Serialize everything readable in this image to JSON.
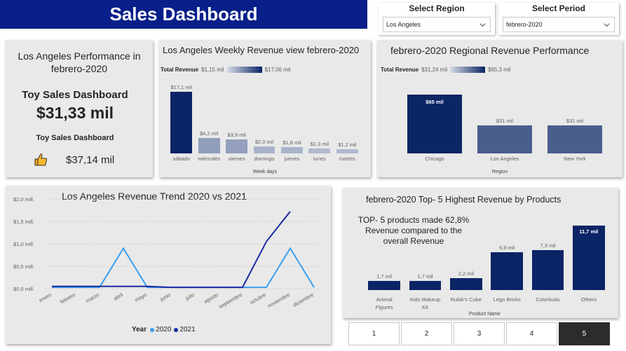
{
  "header": {
    "title": "Sales Dashboard"
  },
  "region_slicer": {
    "label": "Select Region",
    "value": "Los Angeles"
  },
  "period_slicer": {
    "label": "Select Period",
    "value": "febrero-2020"
  },
  "kpi": {
    "title": "Los Angeles Performance in febrero-2020",
    "subtitle": "Toy Sales Dashboard",
    "value": "$31,33 mil",
    "target_label": "Toy Sales Dashboard",
    "target_value": "$37,14 mil",
    "icon": "thumbs-up-icon"
  },
  "weekly": {
    "title": "Los Angeles Weekly Revenue view febrero-2020",
    "legend_label": "Total Revenue",
    "legend_min": "$1,15 mil",
    "legend_max": "$17,06 mil",
    "xlabel": "Week days",
    "chart_data": {
      "type": "bar",
      "categories": [
        "sábado",
        "miércoles",
        "viernes",
        "domingo",
        "jueves",
        "lunes",
        "martes"
      ],
      "values": [
        17.1,
        4.2,
        3.9,
        2.0,
        1.8,
        1.3,
        1.2
      ],
      "labels": [
        "$17,1 mil",
        "$4,2 mil",
        "$3,9 mil",
        "$2,0 mil",
        "$1,8 mil",
        "$1,3 mil",
        "$1,2 mil"
      ],
      "xlabel": "Week days"
    }
  },
  "regional": {
    "title": "febrero-2020 Regional Revenue Performance",
    "legend_label": "Total Revenue",
    "legend_min": "$31,24 mil",
    "legend_max": "$65,3 mil",
    "xlabel": "Region",
    "chart_data": {
      "type": "bar",
      "categories": [
        "Chicago",
        "Los Angeles",
        "New York"
      ],
      "values": [
        65,
        31,
        31
      ],
      "labels": [
        "$65 mil",
        "$31 mil",
        "$31 mil"
      ],
      "xlabel": "Region"
    }
  },
  "trend": {
    "title": "Los Angeles Revenue Trend 2020 vs 2021",
    "legend_title": "Year",
    "chart_data": {
      "type": "line",
      "x": [
        "enero",
        "febrero",
        "marzo",
        "abril",
        "mayo",
        "junio",
        "julio",
        "agosto",
        "septiembre",
        "octubre",
        "noviembre",
        "diciembre"
      ],
      "y_ticks": [
        "$0,0 mill.",
        "$0,5 mill.",
        "$1,0 mill.",
        "$1,5 mill.",
        "$2,0 mill."
      ],
      "ylim": [
        0,
        2.0
      ],
      "series": [
        {
          "name": "2020",
          "color": "#3a9ff0",
          "values": [
            0.03,
            0.03,
            0.03,
            0.9,
            0.03,
            0.03,
            0.03,
            0.03,
            0.03,
            0.03,
            0.9,
            0.03
          ]
        },
        {
          "name": "2021",
          "color": "#1a2aa0",
          "values": [
            0.05,
            0.05,
            0.05,
            0.05,
            0.05,
            0.03,
            0.03,
            0.03,
            0.03,
            1.05,
            1.72,
            null
          ]
        }
      ],
      "legend_position": "bottom-center"
    }
  },
  "products": {
    "title": "febrero-2020 Top- 5 Highest Revenue by Products",
    "note": "TOP- 5 products made 62,8% Revenue compared to the overall Revenue",
    "xlabel": "Product Name",
    "chart_data": {
      "type": "bar",
      "categories": [
        "Animal Figures",
        "Kids Makeup Kit",
        "Rubik's Cube",
        "Lego Bricks",
        "Colorbuds",
        "Others"
      ],
      "values": [
        1.7,
        1.7,
        2.2,
        6.9,
        7.3,
        11.7
      ],
      "labels": [
        "1,7 mil",
        "1,7 mil",
        "2,2 mil",
        "6,9 mil",
        "7,3 mil",
        "11,7 mil"
      ],
      "xlabel": "Product Name"
    }
  },
  "pagination": {
    "pages": [
      "1",
      "2",
      "3",
      "4",
      "5"
    ],
    "active": "5"
  }
}
